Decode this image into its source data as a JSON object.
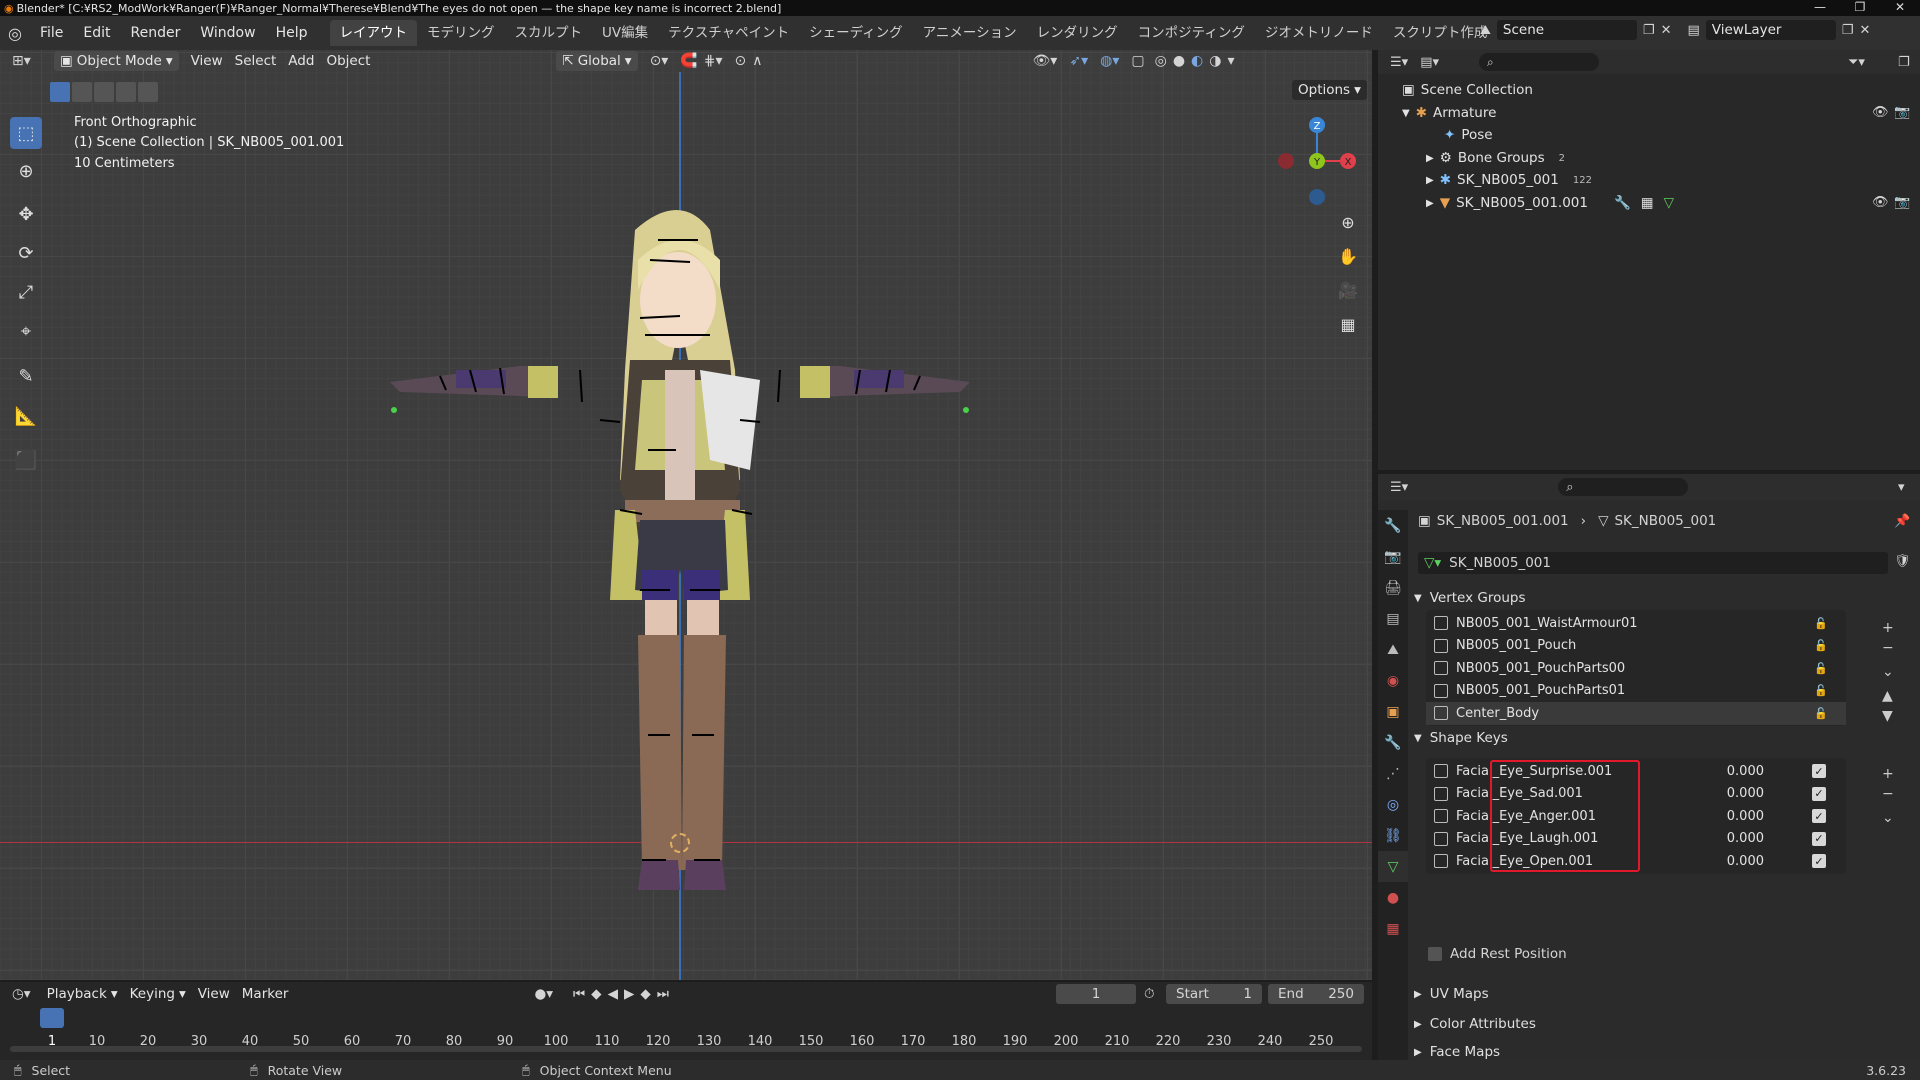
{
  "window": {
    "title": "Blender* [C:¥RS2_ModWork¥Ranger(F)¥Ranger_Normal¥Therese¥Blend¥The eyes do not open — the shape key name is incorrect 2.blend]",
    "controls": [
      "—",
      "❐",
      "✕"
    ]
  },
  "menubar": {
    "menus": [
      "File",
      "Edit",
      "Render",
      "Window",
      "Help"
    ],
    "workspaces": [
      "レイアウト",
      "モデリング",
      "スカルプト",
      "UV編集",
      "テクスチャペイント",
      "シェーディング",
      "アニメーション",
      "レンダリング",
      "コンポジティング",
      "ジオメトリノード",
      "スクリプト作成"
    ],
    "active_workspace": "レイアウト",
    "add_tab": "+",
    "scene": "Scene",
    "view_layer": "ViewLayer"
  },
  "viewport_header": {
    "mode": "Object Mode",
    "menus": [
      "View",
      "Select",
      "Add",
      "Object"
    ],
    "transform_orientation": "Global",
    "options": "Options"
  },
  "viewport_overlay": {
    "view_name": "Front Orthographic",
    "collection_info": "(1) Scene Collection | SK_NB005_001.001",
    "scale": "10 Centimeters"
  },
  "gizmo": {
    "z": "Z",
    "y": "Y",
    "x": "X"
  },
  "outliner": {
    "items": [
      {
        "label": "Scene Collection",
        "icon": "collection-icon"
      },
      {
        "label": "Armature",
        "icon": "armature-icon"
      },
      {
        "label": "Pose",
        "icon": "pose-icon"
      },
      {
        "label": "Bone Groups",
        "icon": "bone-groups-icon",
        "badge": "2"
      },
      {
        "label": "SK_NB005_001",
        "icon": "armature-data-icon",
        "badge": "122"
      },
      {
        "label": "SK_NB005_001.001",
        "icon": "mesh-object-icon"
      }
    ]
  },
  "properties": {
    "breadcrumb_object": "SK_NB005_001.001",
    "breadcrumb_data": "SK_NB005_001",
    "mesh_name": "SK_NB005_001",
    "vertex_groups_title": "Vertex Groups",
    "vertex_groups": [
      "NB005_001_WaistArmour01",
      "NB005_001_Pouch",
      "NB005_001_PouchParts00",
      "NB005_001_PouchParts01",
      "Center_Body"
    ],
    "shape_keys_title": "Shape Keys",
    "shape_keys": [
      {
        "name": "Facial_Eye_Surprise.001",
        "value": "0.000"
      },
      {
        "name": "Facial_Eye_Sad.001",
        "value": "0.000"
      },
      {
        "name": "Facial_Eye_Anger.001",
        "value": "0.000"
      },
      {
        "name": "Facial_Eye_Laugh.001",
        "value": "0.000"
      },
      {
        "name": "Facial_Eye_Open.001",
        "value": "0.000"
      }
    ],
    "add_rest_position": "Add Rest Position",
    "collapsed_panels": [
      "UV Maps",
      "Color Attributes",
      "Face Maps"
    ]
  },
  "timeline": {
    "menus": [
      "Playback",
      "Keying",
      "View",
      "Marker"
    ],
    "current_frame": "1",
    "start_label": "Start",
    "start": "1",
    "end_label": "End",
    "end": "250",
    "ticks": [
      "1",
      "10",
      "20",
      "30",
      "40",
      "50",
      "60",
      "70",
      "80",
      "90",
      "100",
      "110",
      "120",
      "130",
      "140",
      "150",
      "160",
      "170",
      "180",
      "190",
      "200",
      "210",
      "220",
      "230",
      "240",
      "250"
    ]
  },
  "statusbar": {
    "hints": [
      "Select",
      "Rotate View",
      "Object Context Menu"
    ],
    "version": "3.6.23"
  },
  "colors": {
    "accent": "#4772b3",
    "highlight_box": "#e01a2c",
    "x_axis": "#e0404a",
    "y_axis": "#8fc41d",
    "z_axis": "#3a86d6"
  }
}
